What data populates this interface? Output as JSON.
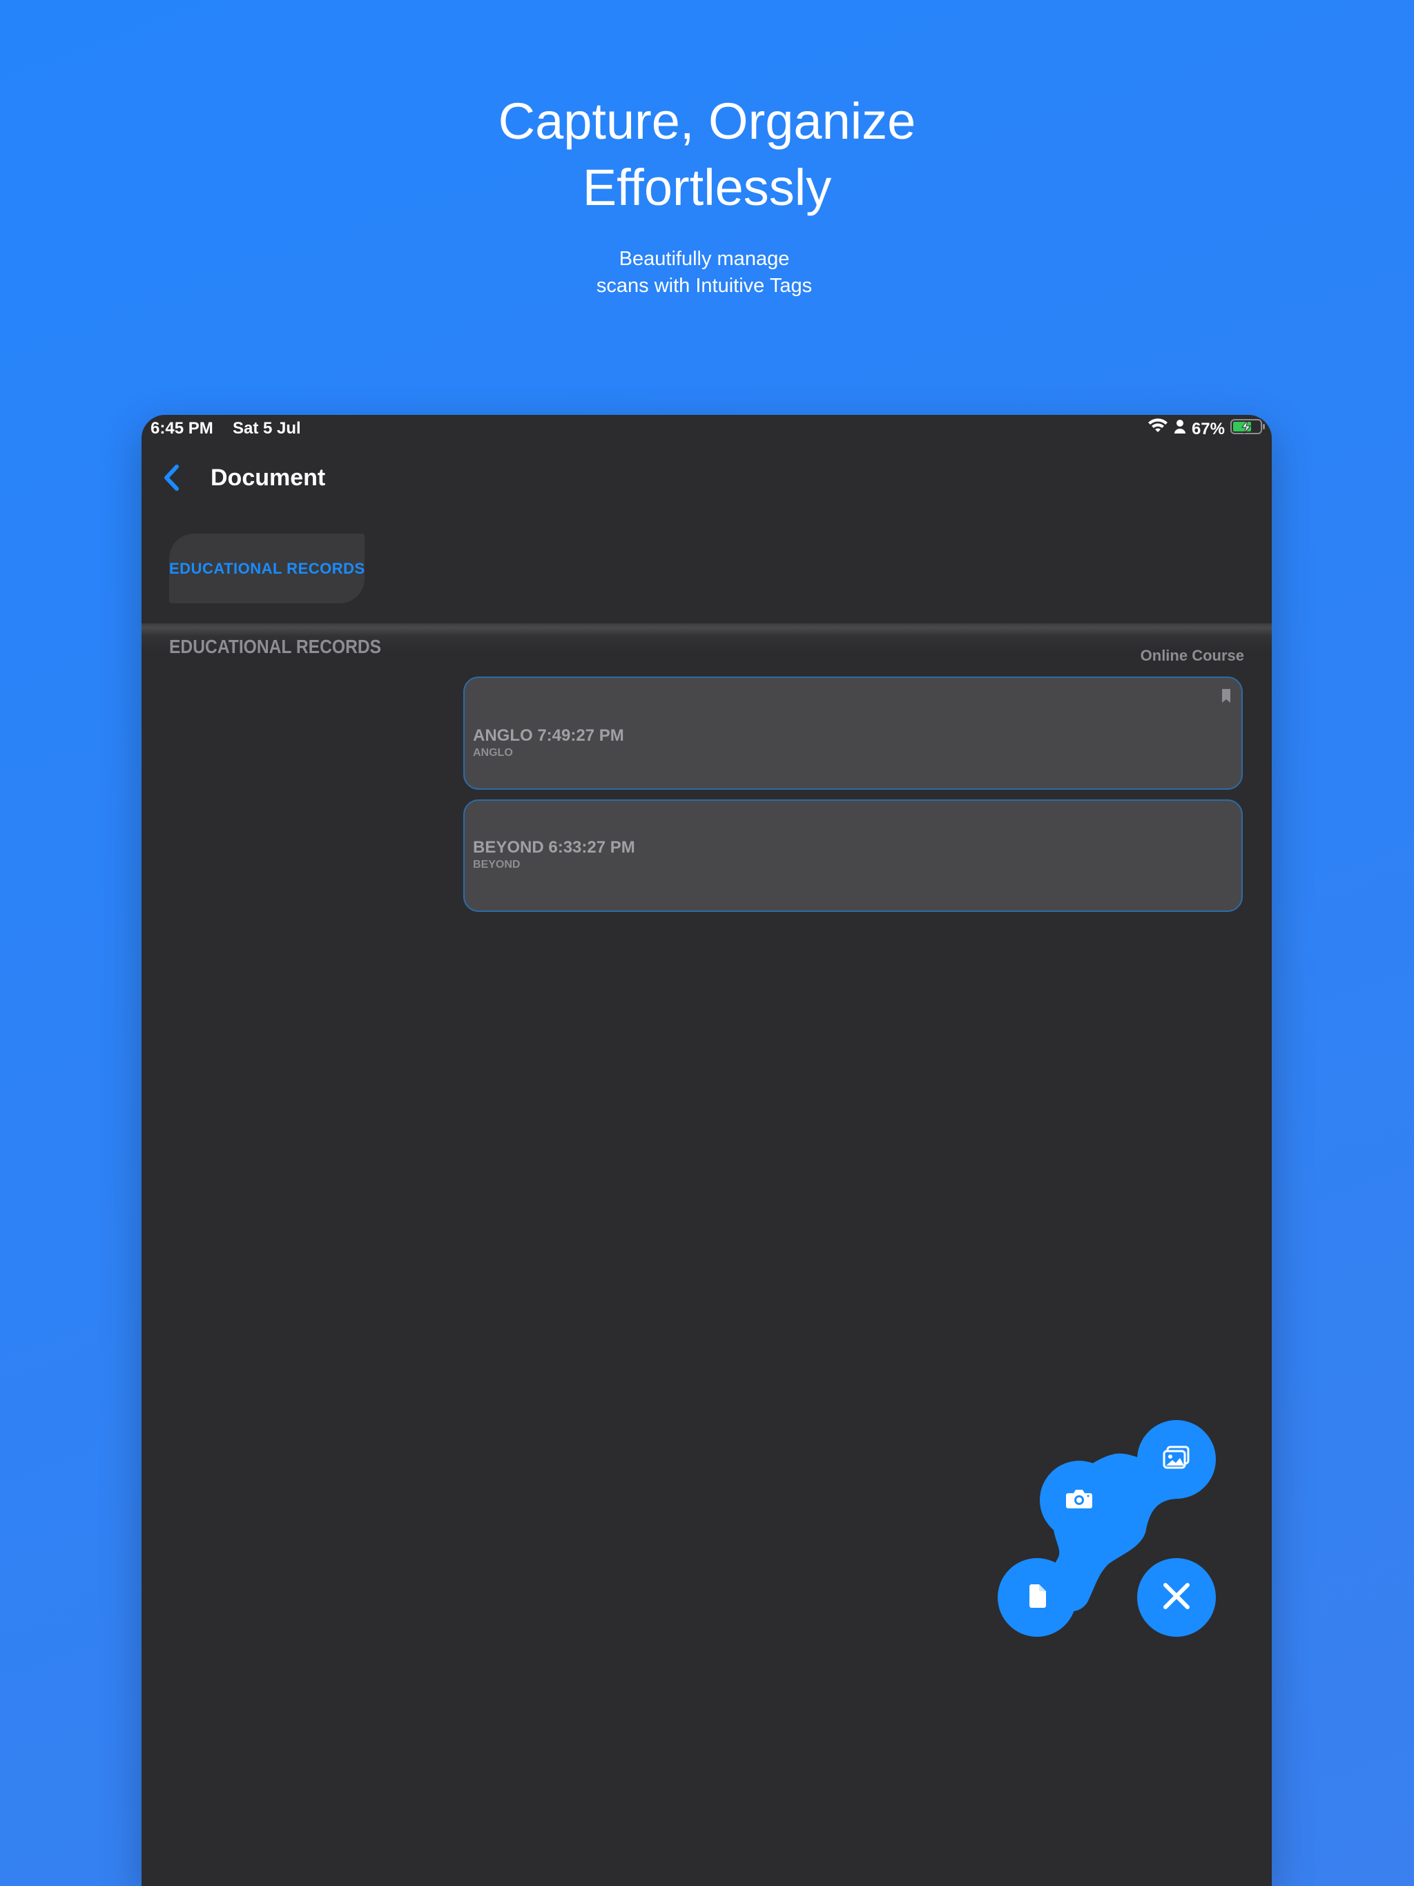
{
  "hero": {
    "title_line1": "Capture, Organize",
    "title_line2": "Effortlessly",
    "subtitle_line1": "Beautifully manage",
    "subtitle_line2": "scans with Intuitive Tags"
  },
  "status_bar": {
    "time": "6:45 PM",
    "date": "Sat 5 Jul",
    "battery": "67%",
    "icons": [
      "wifi-icon",
      "person-icon",
      "battery-icon"
    ]
  },
  "nav": {
    "title": "Document",
    "back_icon": "chevron-left-icon"
  },
  "tag_filter": {
    "label": "EDUCATIONAL RECORDS"
  },
  "section": {
    "title": "EDUCATIONAL RECORDS",
    "meta": "Online Course"
  },
  "documents": [
    {
      "name": "ANGLO 7:49:27 PM",
      "tag": "ANGLO",
      "bookmarked": true
    },
    {
      "name": "BEYOND 6:33:27 PM",
      "tag": "BEYOND",
      "bookmarked": false
    }
  ],
  "fab_menu": {
    "items": [
      "gallery-icon",
      "camera-icon",
      "document-icon",
      "close-icon"
    ]
  },
  "colors": {
    "background": "#2684fb",
    "device_bg": "#2c2c2e",
    "accent": "#1a8cff",
    "card_bg": "#48484a",
    "card_border": "#2e6aa8",
    "muted_text": "#8e8e93"
  }
}
